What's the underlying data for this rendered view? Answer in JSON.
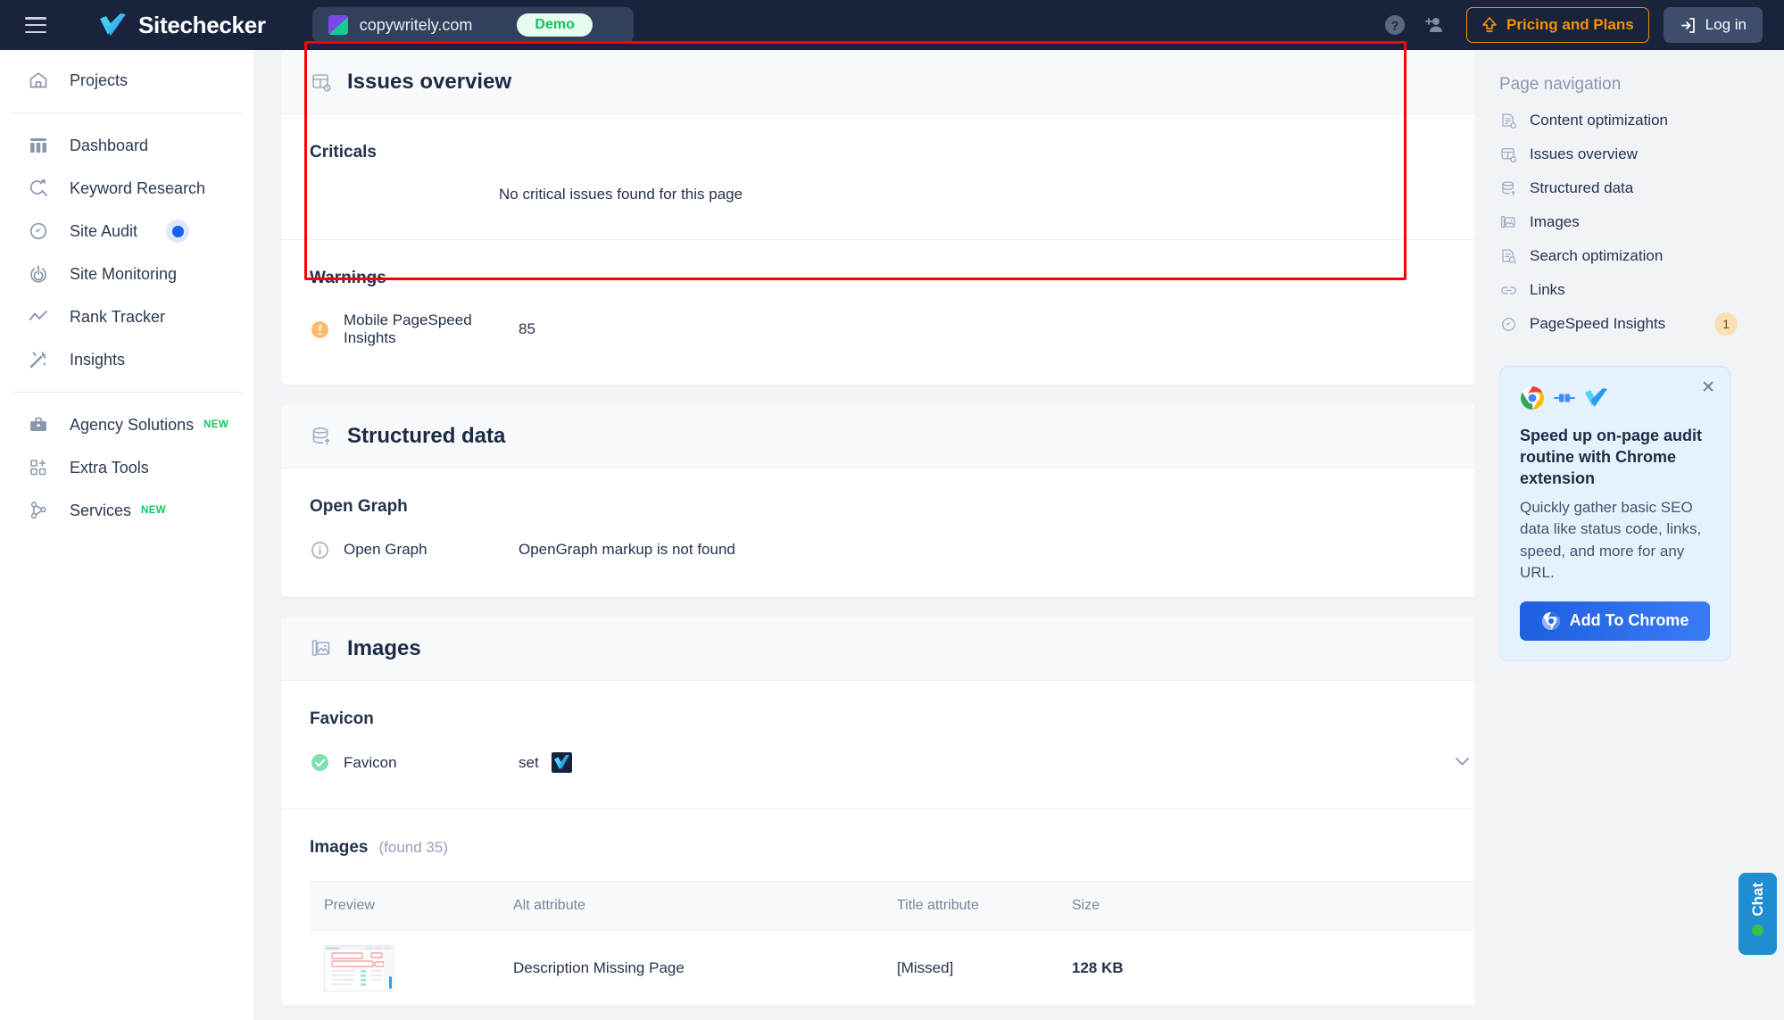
{
  "header": {
    "menu_icon": "hamburger-icon",
    "brand": "Sitechecker",
    "project_url": "copywritely.com",
    "project_badge": "Demo",
    "help_icon": "help-circle-icon",
    "invite_icon": "add-user-icon",
    "pricing_label": "Pricing and Plans",
    "login_label": "Log in",
    "colors": {
      "bg": "#19233c",
      "chip": "#33405c",
      "accent_orange": "#f59000",
      "badge_green": "#13c560"
    }
  },
  "sidebar": {
    "groups": [
      {
        "items": [
          {
            "label": "Projects",
            "icon": "home-icon"
          }
        ]
      },
      {
        "items": [
          {
            "label": "Dashboard",
            "icon": "dashboard-icon"
          },
          {
            "label": "Keyword Research",
            "icon": "keyword-search-icon",
            "chevron": "›"
          },
          {
            "label": "Site Audit",
            "icon": "gauge-icon",
            "active": true
          },
          {
            "label": "Site Monitoring",
            "icon": "radar-icon"
          },
          {
            "label": "Rank Tracker",
            "icon": "trend-line-icon"
          },
          {
            "label": "Insights",
            "icon": "magic-wand-icon"
          }
        ]
      },
      {
        "items": [
          {
            "label": "Agency Solutions",
            "icon": "briefcase-icon",
            "tag": "NEW"
          },
          {
            "label": "Extra Tools",
            "icon": "grid-plus-icon"
          },
          {
            "label": "Services",
            "icon": "share-nodes-icon",
            "tag": "NEW"
          }
        ]
      }
    ],
    "active_color": "#1261f0"
  },
  "main": {
    "issues_overview": {
      "title": "Issues overview",
      "icon": "issues-overview-icon",
      "criticals": {
        "heading": "Criticals",
        "message": "No critical issues found for this page"
      },
      "warnings": {
        "heading": "Warnings",
        "items": [
          {
            "icon": "warning-icon",
            "label": "Mobile PageSpeed Insights",
            "value": "85"
          }
        ]
      }
    },
    "structured_data": {
      "title": "Structured data",
      "icon": "database-icon",
      "open_graph": {
        "heading": "Open Graph",
        "row_icon": "info-icon",
        "row_label": "Open Graph",
        "row_value": "OpenGraph markup is not found"
      }
    },
    "images": {
      "title": "Images",
      "icon": "image-icon",
      "favicon": {
        "heading": "Favicon",
        "row_icon": "check-circle-icon",
        "row_label": "Favicon",
        "row_value": "set",
        "expand_icon": "chevron-down-icon"
      },
      "list": {
        "heading": "Images",
        "found": "(found 35)",
        "columns": [
          "Preview",
          "Alt attribute",
          "Title attribute",
          "Size"
        ],
        "rows": [
          {
            "preview": "screenshot-thumbnail",
            "alt": "Description Missing Page",
            "title": "[Missed]",
            "title_missing": true,
            "size": "128 KB"
          }
        ]
      }
    }
  },
  "right_panel": {
    "title": "Page navigation",
    "items": [
      {
        "label": "Content optimization",
        "icon": "content-optimization-icon"
      },
      {
        "label": "Issues overview",
        "icon": "issues-overview-icon"
      },
      {
        "label": "Structured data",
        "icon": "database-icon"
      },
      {
        "label": "Images",
        "icon": "image-icon"
      },
      {
        "label": "Search optimization",
        "icon": "search-optimization-icon"
      },
      {
        "label": "Links",
        "icon": "link-icon"
      },
      {
        "label": "PageSpeed Insights",
        "icon": "gauge-icon",
        "badge": "1"
      }
    ],
    "promo": {
      "close_icon": "close-icon",
      "icons": [
        "chrome-icon",
        "plug-connect-icon",
        "sitechecker-check-icon"
      ],
      "title": "Speed up on-page audit routine with Chrome extension",
      "text": "Quickly gather basic SEO data like status code, links, speed, and more for any URL.",
      "button_label": "Add To Chrome",
      "button_icon": "chrome-icon",
      "bg": "#e3f2fd",
      "button_color": "#2b6ce8"
    }
  },
  "chat_widget": {
    "label": "Chat",
    "status_dot_color": "#35c24a",
    "bg": "#1e8ed1"
  },
  "highlight": {
    "color": "#ff0000",
    "target": "issues-overview-card"
  }
}
